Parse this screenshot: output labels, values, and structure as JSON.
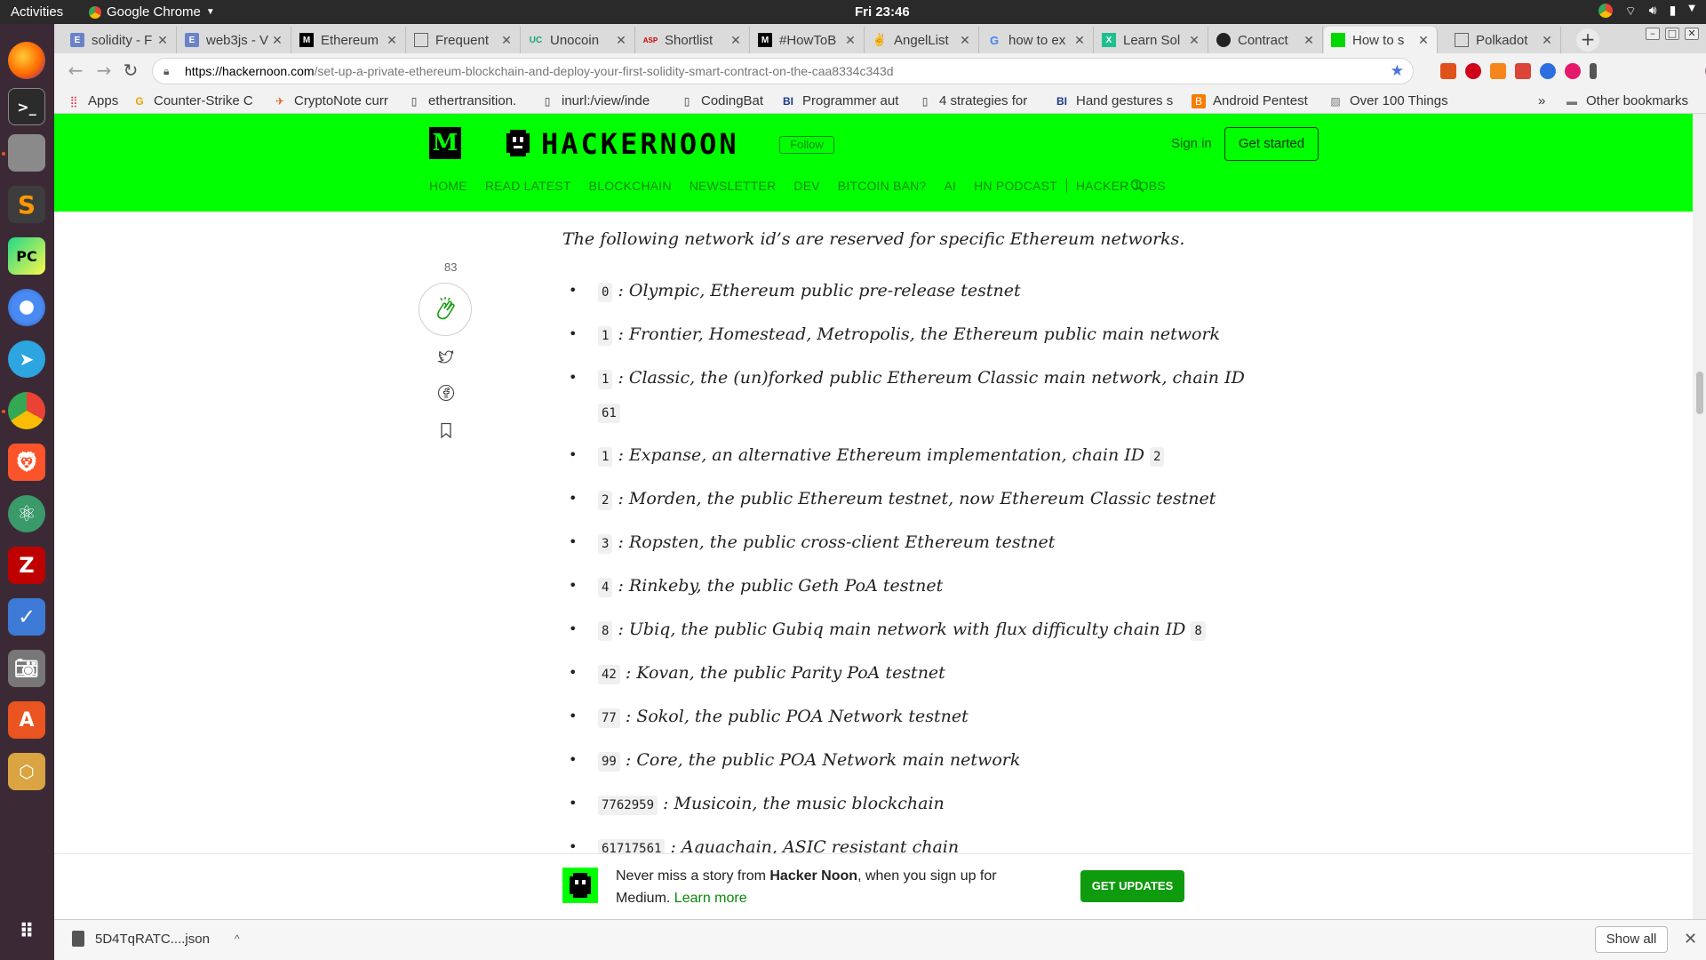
{
  "topbar": {
    "activities": "Activities",
    "app_name": "Google Chrome",
    "clock": "Fri 23:46"
  },
  "dock": {
    "items": [
      "terminal",
      "firefox",
      "files",
      "sublime-text",
      "pycharm",
      "chromium",
      "telegram",
      "chrome",
      "brave",
      "atom",
      "filezilla",
      "tasks",
      "screenshot",
      "software-center",
      "virtualbox"
    ]
  },
  "tabs": [
    {
      "label": "solidity - F",
      "favicon": "ETH"
    },
    {
      "label": "web3js - V",
      "favicon": "ETH"
    },
    {
      "label": "Ethereum",
      "favicon": "M"
    },
    {
      "label": "Frequent",
      "favicon": "doc"
    },
    {
      "label": "Unocoin",
      "favicon": "UC"
    },
    {
      "label": "Shortlist",
      "favicon": "ASP"
    },
    {
      "label": "#HowToB",
      "favicon": "M"
    },
    {
      "label": "AngelList",
      "favicon": "hand"
    },
    {
      "label": "how to ex",
      "favicon": "G"
    },
    {
      "label": "Learn Sol",
      "favicon": "X"
    },
    {
      "label": "Contract",
      "favicon": "gh"
    },
    {
      "label": "How to s",
      "favicon": "hn",
      "active": true
    },
    {
      "label": "Polkadot",
      "favicon": "doc"
    }
  ],
  "address_bar": {
    "host": "https://hackernoon.com",
    "path": "/set-up-a-private-ethereum-blockchain-and-deploy-your-first-solidity-smart-contract-on-the-caa8334c343d"
  },
  "bookmarks": [
    {
      "label": "Apps",
      "icon": "apps-icon"
    },
    {
      "label": "Counter-Strike C",
      "icon": "cs-icon"
    },
    {
      "label": "CryptoNote curr",
      "icon": "rocket-icon"
    },
    {
      "label": "ethertransition.",
      "icon": "page-icon"
    },
    {
      "label": "inurl:/view/inde",
      "icon": "page-icon"
    },
    {
      "label": "CodingBat",
      "icon": "page-icon"
    },
    {
      "label": "Programmer aut",
      "icon": "bi-icon"
    },
    {
      "label": "4 strategies for",
      "icon": "page-icon"
    },
    {
      "label": "Hand gestures s",
      "icon": "bi-icon"
    },
    {
      "label": "Android Pentest",
      "icon": "blogger-icon"
    },
    {
      "label": "Over 100 Things",
      "icon": "image-icon"
    }
  ],
  "bookmarks_overflow": "»",
  "other_bookmarks": "Other bookmarks",
  "site": {
    "wordmark": "HACKERNOON",
    "follow": "Follow",
    "signin": "Sign in",
    "get_started": "Get started",
    "nav": [
      "HOME",
      "READ LATEST",
      "BLOCKCHAIN",
      "NEWSLETTER",
      "DEV",
      "BITCOIN BAN?",
      "AI",
      "HN PODCAST",
      "HACKER JOBS"
    ]
  },
  "article": {
    "intro": "The following network id’s are reserved for specific Ethereum networks.",
    "claps": "83",
    "networks": [
      {
        "id": "0",
        "desc": " : Olympic, Ethereum public pre-release testnet"
      },
      {
        "id": "1",
        "desc": " : Frontier, Homestead, Metropolis, the Ethereum public main network"
      },
      {
        "id": "1",
        "desc": " : Classic, the (un)forked public Ethereum Classic main network, chain ID ",
        "chain": "61"
      },
      {
        "id": "1",
        "desc": " : Expanse, an alternative Ethereum implementation, chain ID ",
        "chain": "2"
      },
      {
        "id": "2",
        "desc": " : Morden, the public Ethereum testnet, now Ethereum Classic testnet"
      },
      {
        "id": "3",
        "desc": " : Ropsten, the public cross-client Ethereum testnet"
      },
      {
        "id": "4",
        "desc": " : Rinkeby, the public Geth PoA testnet"
      },
      {
        "id": "8",
        "desc": " : Ubiq, the public Gubiq main network with flux difficulty chain ID ",
        "chain": "8"
      },
      {
        "id": "42",
        "desc": " : Kovan, the public Parity PoA testnet"
      },
      {
        "id": "77",
        "desc": " : Sokol, the public POA Network testnet"
      },
      {
        "id": "99",
        "desc": " : Core, the public POA Network main network"
      },
      {
        "id": "7762959",
        "desc": " : Musicoin, the music blockchain"
      },
      {
        "id": "61717561",
        "desc": " : Aquachain, ASIC resistant chain"
      }
    ]
  },
  "banner": {
    "text_before": "Never miss a story from ",
    "brand": "Hacker Noon",
    "text_after": ", when you sign up for Medium. ",
    "learn_more": "Learn more",
    "button": "GET UPDATES"
  },
  "downloads": {
    "file": "5D4TqRATC....json",
    "show_all": "Show all"
  },
  "colors": {
    "hn_green": "#00ff00",
    "button_green": "#0e9b0e",
    "dock": "#3b2a36"
  }
}
